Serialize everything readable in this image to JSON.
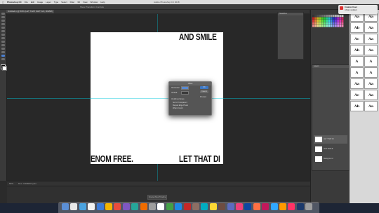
{
  "menubar": {
    "apple": "",
    "app_name": "Photoshop CC",
    "items": [
      "File",
      "Edit",
      "Image",
      "Layer",
      "Type",
      "Select",
      "Filter",
      "3D",
      "View",
      "Window",
      "Help"
    ],
    "window_title": "Adobe Photoshop CC 2018"
  },
  "options": {
    "label": "Show Transform Controls"
  },
  "document": {
    "tab_title": "Untitled-1 @ 50% (LET THAT SHIT GO, RGB/8)",
    "canvas_texts": {
      "top_right": "AND SMILE",
      "bottom_left": "ENOM FREE.",
      "bottom_right": "LET THAT DI"
    }
  },
  "dialog": {
    "title": "Offset",
    "horizontal_label": "Horizontal:",
    "vertical_label": "Vertical:",
    "undefined_label": "Undefined Areas",
    "set_background": "Set to Transparent",
    "repeat_edge": "Repeat Edge Pixels",
    "wrap_around": "Wrap Around",
    "ok_label": "OK",
    "cancel_label": "Cancel",
    "preview_label": "Preview"
  },
  "status": {
    "zoom": "50%",
    "doc_info": "Doc: 3.00M/0 bytes"
  },
  "timeline": {
    "button_label": "Create Video Timeline"
  },
  "notification": {
    "title": "Creative Cloud",
    "body": "Library updated"
  },
  "panels": {
    "swatches_title": "Swatches",
    "layers_title": "Layers",
    "layer_names": [
      "LET THAT DI",
      "AND SMILE",
      "Background"
    ]
  },
  "fonts": [
    "Aa",
    "Aa",
    "Ab",
    "Aa",
    "Ac",
    "Aa",
    "Ab",
    "Aa",
    "A",
    "A",
    "A",
    "A",
    "Aa",
    "Aa",
    "Ac",
    "Aa",
    "Ab",
    "Aa"
  ]
}
